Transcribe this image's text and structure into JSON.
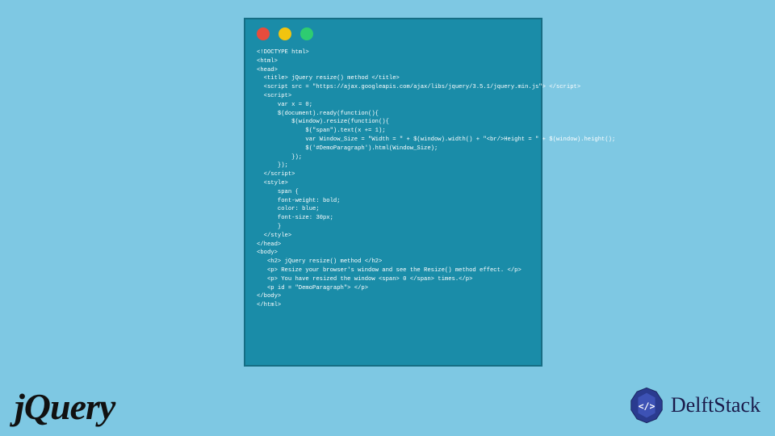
{
  "code": {
    "lines": [
      "<!DOCTYPE html>",
      "<html>",
      "<head>",
      "  <title> jQuery resize() method </title>",
      "  <script src = \"https://ajax.googleapis.com/ajax/libs/jquery/3.5.1/jquery.min.js\"> </script>",
      "  <script>",
      "      var x = 0;",
      "      $(document).ready(function(){",
      "          $(window).resize(function(){",
      "              $(\"span\").text(x += 1);",
      "              var Window_Size = \"Width = \" + $(window).width() + \"<br/>Height = \" + $(window).height();",
      "              $('#DemoParagraph').html(Window_Size);",
      "          });",
      "      });",
      "  </script>",
      "  <style>",
      "      span {",
      "      font-weight: bold;",
      "      color: blue;",
      "      font-size: 30px;",
      "      }",
      "  </style>",
      "</head>",
      "<body>",
      "   <h2> jQuery resize() method </h2>",
      "   <p> Resize your browser's window and see the Resize() method effect. </p>",
      "   <p> You have resized the window <span> 0 </span> times.</p>",
      "   <p id = \"DemoParagraph\"> </p>",
      "</body>",
      "</html>"
    ]
  },
  "logos": {
    "jquery": "jQuery",
    "delft": "DelftStack"
  }
}
